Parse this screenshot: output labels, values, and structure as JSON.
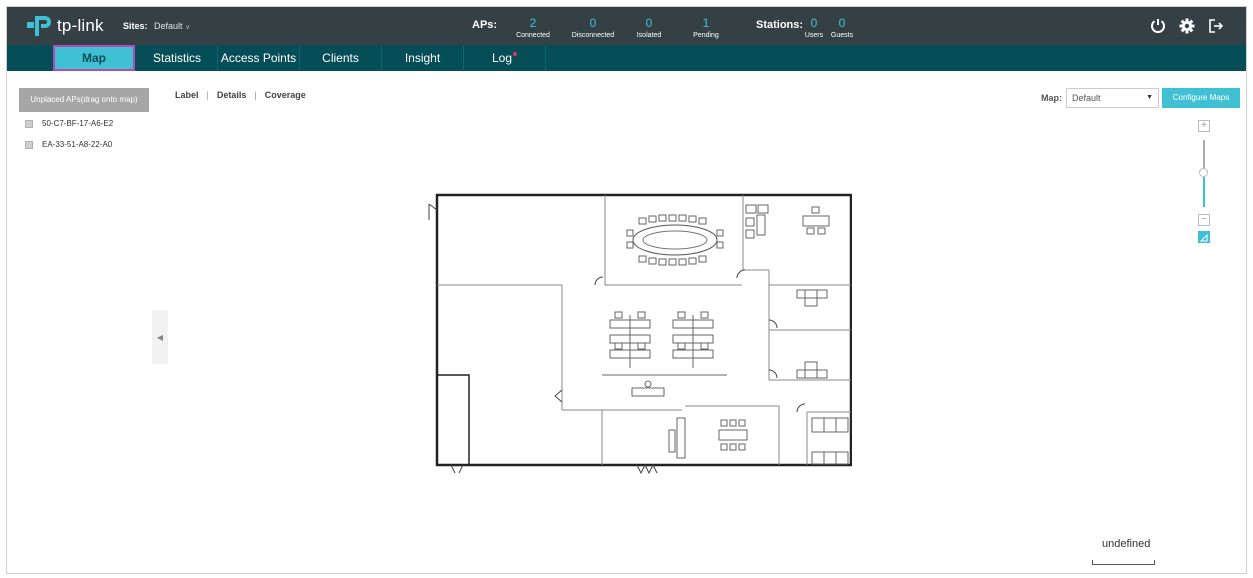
{
  "header": {
    "logo_text": "tp-link",
    "sites_label": "Sites:",
    "site_value": "Default",
    "aps_label": "APs:",
    "ap_stats": [
      {
        "value": "2",
        "label": "Connected"
      },
      {
        "value": "0",
        "label": "Disconnected"
      },
      {
        "value": "0",
        "label": "Isolated"
      },
      {
        "value": "1",
        "label": "Pending"
      }
    ],
    "stations_label": "Stations:",
    "station_stats": [
      {
        "value": "0",
        "label": "Users"
      },
      {
        "value": "0",
        "label": "Guests"
      }
    ],
    "icons": [
      "refresh-icon",
      "gear-icon",
      "logout-icon"
    ]
  },
  "nav": {
    "tabs": [
      {
        "label": "Map",
        "active": true
      },
      {
        "label": "Statistics"
      },
      {
        "label": "Access Points"
      },
      {
        "label": "Clients"
      },
      {
        "label": "Insight"
      },
      {
        "label": "Log",
        "badge": true
      }
    ]
  },
  "sidebar": {
    "unplaced_button": "Unplaced APs(drag onto map)",
    "aps": [
      "50-C7-BF-17-A6-E2",
      "EA-33-51-A8-22-A0"
    ]
  },
  "view_tabs": [
    "Label",
    "Details",
    "Coverage"
  ],
  "map_controls": {
    "map_label": "Map:",
    "map_select": "Default",
    "configure_button": "Configure Maps",
    "zoom_in": "+",
    "zoom_out": "−"
  },
  "scale": {
    "text": "undefined"
  },
  "colors": {
    "topbar": "#354045",
    "navbar": "#054e57",
    "accent": "#3fc1d3",
    "active_outline": "#b54bb8"
  }
}
